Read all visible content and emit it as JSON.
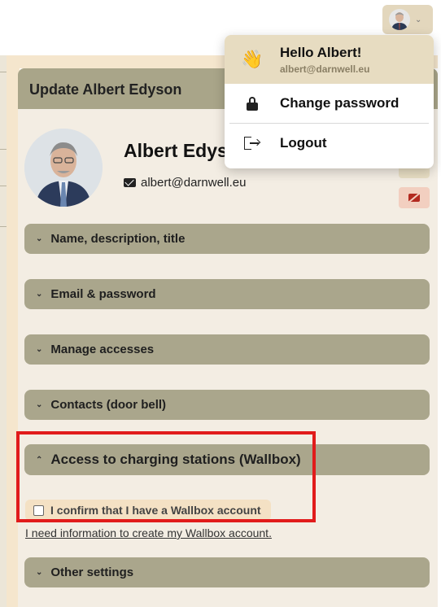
{
  "topbar": {
    "avatar_chevron": "⌄"
  },
  "card": {
    "title": "Update Albert Edyson"
  },
  "profile": {
    "name": "Albert Edyson",
    "email": "albert@darnwell.eu"
  },
  "accordions": [
    {
      "label": "Name, description, title",
      "chevron": "⌄",
      "expanded": false
    },
    {
      "label": "Email & password",
      "chevron": "⌄",
      "expanded": false
    },
    {
      "label": "Manage accesses",
      "chevron": "⌄",
      "expanded": false
    },
    {
      "label": "Contacts (door bell)",
      "chevron": "⌄",
      "expanded": false
    },
    {
      "label": "Access to charging stations (Wallbox)",
      "chevron": "⌃",
      "expanded": true
    },
    {
      "label": "Other settings",
      "chevron": "⌄",
      "expanded": false
    }
  ],
  "wallbox": {
    "confirm_label": "I confirm that I have a Wallbox account",
    "confirm_checked": false,
    "info_link": "I need information to create my Wallbox account."
  },
  "dropdown": {
    "hello": "Hello Albert!",
    "email": "albert@darnwell.eu",
    "wave_icon": "👋",
    "items": [
      {
        "label": "Change password",
        "icon": "lock-icon"
      },
      {
        "label": "Logout",
        "icon": "logout-icon"
      }
    ]
  },
  "colors": {
    "accordion": "#aaa68c",
    "header": "#a9a589",
    "highlight": "#e11b1b",
    "dropdown_header": "#e7dcc1"
  }
}
